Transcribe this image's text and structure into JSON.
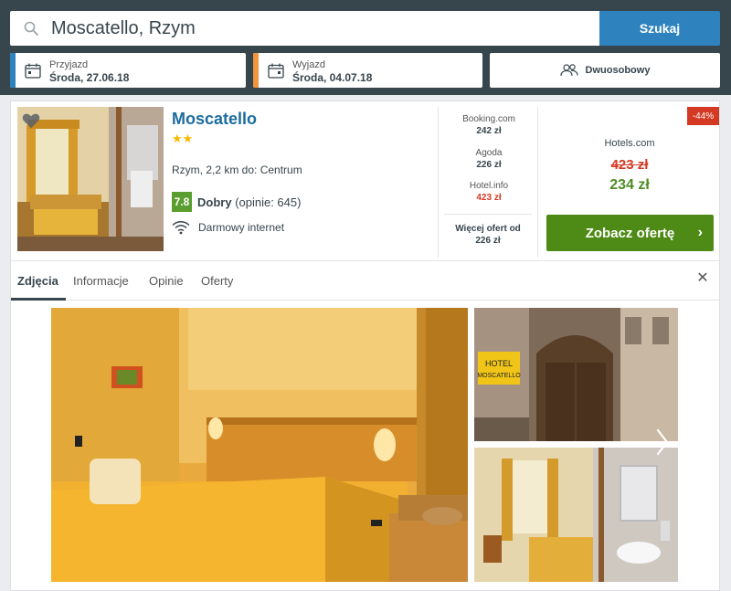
{
  "search": {
    "value": "Moscatello, Rzym",
    "button_label": "Szukaj"
  },
  "checkin": {
    "label": "Przyjazd",
    "value": "Środa, 27.06.18"
  },
  "checkout": {
    "label": "Wyjazd",
    "value": "Środa, 04.07.18"
  },
  "room": {
    "value": "Dwuosobowy"
  },
  "hotel": {
    "name": "Moscatello",
    "stars": "★★",
    "star_count": 2,
    "location": "Rzym, 2,2 km do: Centrum",
    "rating_score": "7.8",
    "rating_word": "Dobry",
    "rating_reviews": "(opinie: 645)",
    "amenity": "Darmowy internet"
  },
  "deals": [
    {
      "site": "Booking.com",
      "price": "242 zł"
    },
    {
      "site": "Agoda",
      "price": "226 zł"
    },
    {
      "site": "Hotel.info",
      "price": "423 zł"
    }
  ],
  "more_deals": {
    "label": "Więcej ofert od",
    "price": "226 zł"
  },
  "best_deal": {
    "discount": "-44%",
    "site": "Hotels.com",
    "old_price": "423 zł",
    "new_price": "234 zł",
    "button_label": "Zobacz ofertę"
  },
  "tabs": [
    {
      "label": "Zdjęcia"
    },
    {
      "label": "Informacje"
    },
    {
      "label": "Opinie"
    },
    {
      "label": "Oferty"
    }
  ],
  "photo_signs": {
    "line1": "HOTEL",
    "line2": "MOSCATELLO"
  },
  "colors": {
    "header_bg": "#37454d",
    "accent_blue": "#2e83bf",
    "checkout_orange": "#f2953d",
    "deal_green": "#4e8a16",
    "price_red": "#d43a23",
    "rating_green": "#5a9e2f",
    "hotel_name_blue": "#1c6c9f"
  }
}
